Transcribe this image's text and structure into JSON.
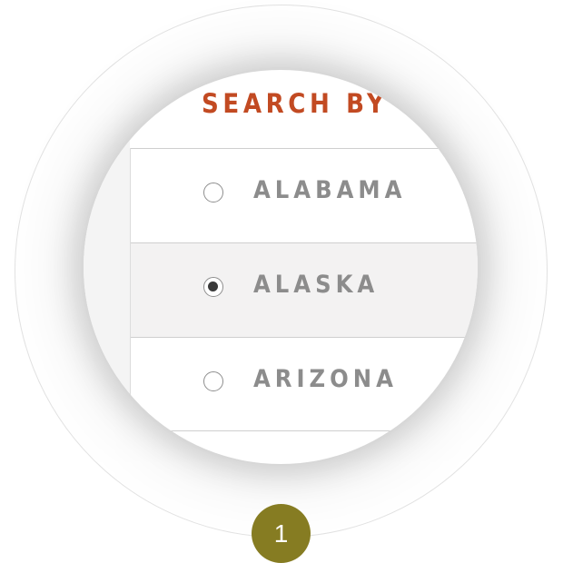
{
  "heading": "SEARCH BY STATE",
  "states": [
    {
      "label": "ALABAMA",
      "selected": false
    },
    {
      "label": "ALASKA",
      "selected": true
    },
    {
      "label": "ARIZONA",
      "selected": false
    }
  ],
  "step_badge": "1",
  "colors": {
    "heading": "#c24a22",
    "label": "#8c8c8c",
    "selected_row_bg": "#f3f2f2",
    "badge_bg": "#867c22",
    "radio_fill": "#3a3a3a"
  },
  "icons": [
    "radio-unchecked-icon",
    "radio-checked-icon"
  ]
}
